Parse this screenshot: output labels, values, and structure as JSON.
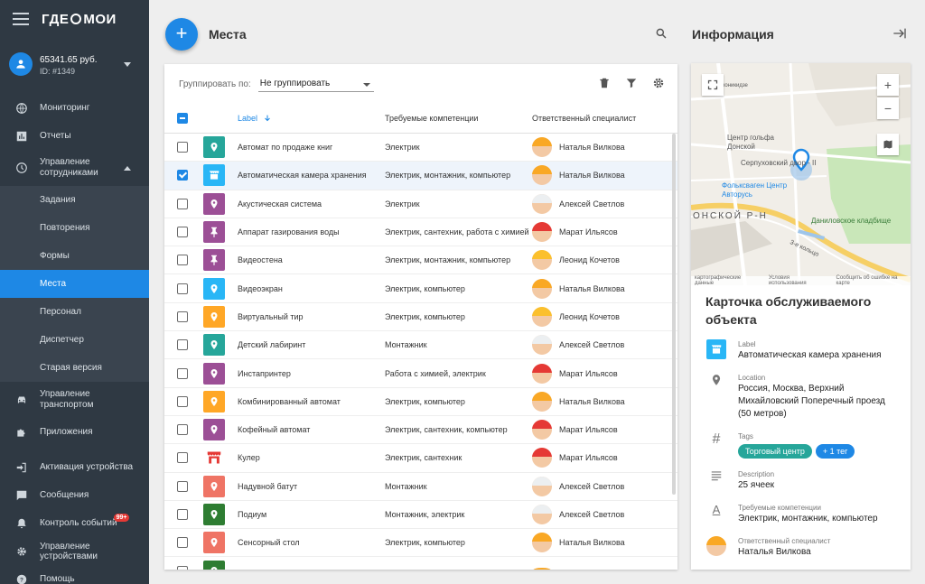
{
  "app": {
    "logo_left": "ГДЕ",
    "logo_right": "МОИ"
  },
  "account": {
    "balance": "65341.65 руб.",
    "id": "ID: #1349"
  },
  "menu": [
    {
      "label": "Мониторинг"
    },
    {
      "label": "Отчеты"
    },
    {
      "label": "Управление сотрудниками"
    },
    {
      "label": "Задания"
    },
    {
      "label": "Повторения"
    },
    {
      "label": "Формы"
    },
    {
      "label": "Места"
    },
    {
      "label": "Персонал"
    },
    {
      "label": "Диспетчер"
    },
    {
      "label": "Старая версия"
    },
    {
      "label": "Управление транспортом"
    },
    {
      "label": "Приложения"
    },
    {
      "label": "Активация устройства"
    },
    {
      "label": "Сообщения"
    },
    {
      "label": "Контроль событий",
      "badge": "99+"
    },
    {
      "label": "Управление устройствами"
    },
    {
      "label": "Помощь"
    }
  ],
  "main": {
    "title": "Места",
    "group_by_label": "Группировать по:",
    "group_by_value": "Не группировать",
    "columns": {
      "label": "Label",
      "competences": "Требуемые компетенции",
      "specialist": "Ответственный специалист"
    },
    "rows": [
      {
        "label": "Автомат по продаже книг",
        "comp": "Электрик",
        "spec": "Наталья Вилкова",
        "color": "#26a69a",
        "icon": "pin",
        "hat": "#f9a825",
        "checked": false
      },
      {
        "label": "Автоматическая камера хранения",
        "comp": "Электрик, монтажник, компьютер",
        "spec": "Наталья Вилкова",
        "color": "#29b6f6",
        "icon": "store",
        "hat": "#f9a825",
        "checked": true
      },
      {
        "label": "Акустическая система",
        "comp": "Электрик",
        "spec": "Алексей Светлов",
        "color": "#9c4f96",
        "icon": "pin",
        "hat": "#eceff1",
        "checked": false
      },
      {
        "label": "Аппарат газирования воды",
        "comp": "Электрик, сантехник, работа с химией",
        "spec": "Марат Ильясов",
        "color": "#9c4f96",
        "icon": "pushpin",
        "hat": "#e53935",
        "checked": false
      },
      {
        "label": "Видеостена",
        "comp": "Электрик, монтажник, компьютер",
        "spec": "Леонид Кочетов",
        "color": "#9c4f96",
        "icon": "pushpin",
        "hat": "#fbc02d",
        "checked": false
      },
      {
        "label": "Видеоэкран",
        "comp": "Электрик, компьютер",
        "spec": "Наталья Вилкова",
        "color": "#29b6f6",
        "icon": "pin",
        "hat": "#f9a825",
        "checked": false
      },
      {
        "label": "Виртуальный тир",
        "comp": "Электрик, компьютер",
        "spec": "Леонид Кочетов",
        "color": "#ffa726",
        "icon": "pin",
        "hat": "#fbc02d",
        "checked": false
      },
      {
        "label": "Детский лабиринт",
        "comp": "Монтажник",
        "spec": "Алексей Светлов",
        "color": "#26a69a",
        "icon": "pin",
        "hat": "#eceff1",
        "checked": false
      },
      {
        "label": "Инстапринтер",
        "comp": "Работа с химией, электрик",
        "spec": "Марат Ильясов",
        "color": "#9c4f96",
        "icon": "pin",
        "hat": "#e53935",
        "checked": false
      },
      {
        "label": "Комбинированный автомат",
        "comp": "Электрик, компьютер",
        "spec": "Наталья Вилкова",
        "color": "#ffa726",
        "icon": "pin",
        "hat": "#f9a825",
        "checked": false
      },
      {
        "label": "Кофейный автомат",
        "comp": "Электрик, сантехник, компьютер",
        "spec": "Марат Ильясов",
        "color": "#9c4f96",
        "icon": "pin",
        "hat": "#e53935",
        "checked": false
      },
      {
        "label": "Кулер",
        "comp": "Электрик, сантехник",
        "spec": "Марат Ильясов",
        "color": "#e53935",
        "icon": "store-only",
        "hat": "#e53935",
        "checked": false
      },
      {
        "label": "Надувной батут",
        "comp": "Монтажник",
        "spec": "Алексей Светлов",
        "color": "#ef7465",
        "icon": "pin",
        "hat": "#eceff1",
        "checked": false
      },
      {
        "label": "Подиум",
        "comp": "Монтажник, электрик",
        "spec": "Алексей Светлов",
        "color": "#2e7d32",
        "icon": "pin",
        "hat": "#eceff1",
        "checked": false
      },
      {
        "label": "Сенсорный стол",
        "comp": "Электрик, компьютер",
        "spec": "Наталья Вилкова",
        "color": "#ef7465",
        "icon": "pin",
        "hat": "#f9a825",
        "checked": false
      },
      {
        "label": "",
        "comp": "",
        "spec": "",
        "color": "#2e7d32",
        "icon": "pin",
        "hat": "#f9a825",
        "checked": false
      }
    ]
  },
  "info": {
    "title": "Информация",
    "map": {
      "labels": [
        "Орджоникидзе",
        "Центр гольфа Донской",
        "Серпуховский двор - II",
        "Фольксваген Центр Авторусь",
        "ОНСКОЙ Р-Н",
        "Даниловское кладбище",
        "3-е кольцо"
      ],
      "copyright": [
        "картографические данные",
        "Условия использования",
        "Сообщить об ошибке на карте"
      ]
    },
    "card_title": "Карточка обслуживаемого объекта",
    "fields": {
      "label_caption": "Label",
      "label_value": "Автоматическая камера хранения",
      "location_caption": "Location",
      "location_value": "Россия, Москва, Верхний Михайловский Поперечный проезд (50 метров)",
      "tags_caption": "Tags",
      "tags": [
        "Торговый центр",
        "+ 1 тег"
      ],
      "tag_colors": [
        "#26a69a",
        "#1e88e5"
      ],
      "description_caption": "Description",
      "description_value": "25 ячеек",
      "competences_caption": "Требуемые компетенции",
      "competences_value": "Электрик, монтажник, компьютер",
      "specialist_caption": "Ответственный специалист",
      "specialist_value": "Наталья Вилкова"
    }
  }
}
